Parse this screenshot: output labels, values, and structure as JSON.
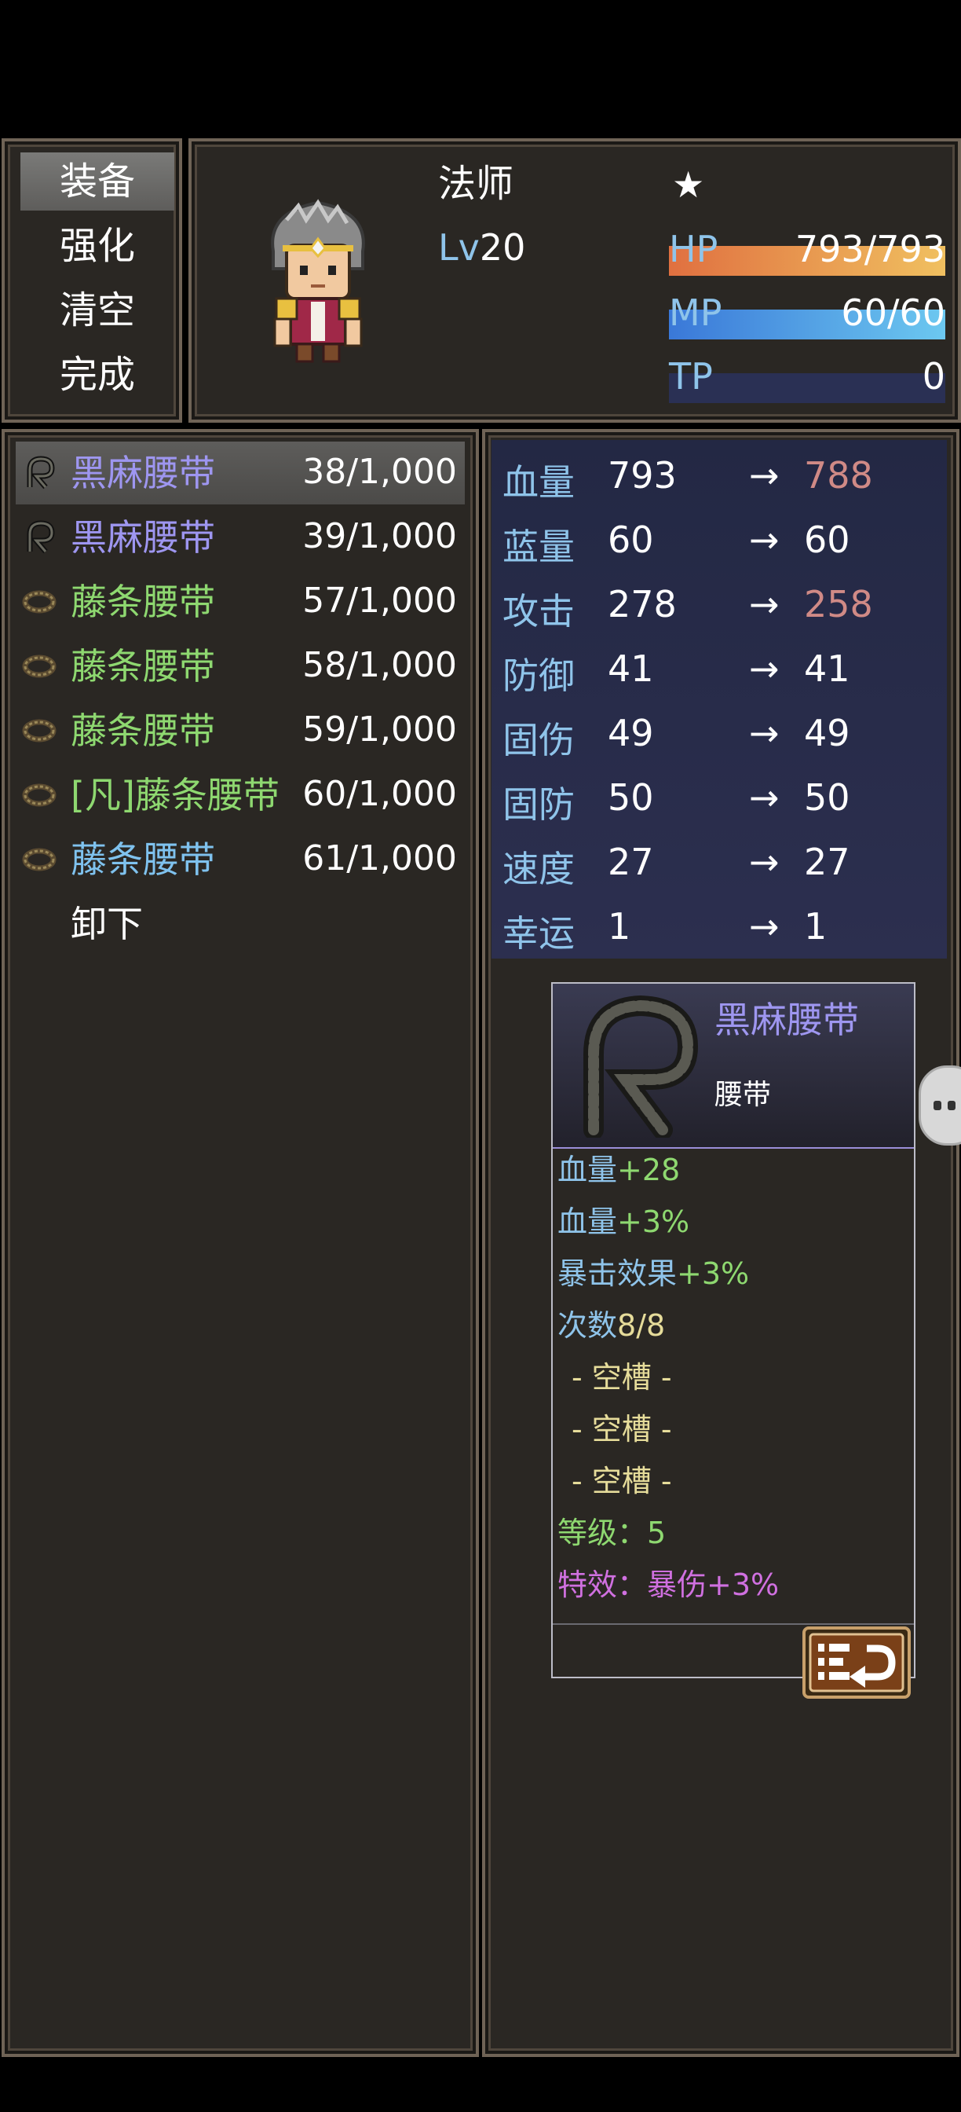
{
  "commands": [
    {
      "label": "装备"
    },
    {
      "label": "强化"
    },
    {
      "label": "清空"
    },
    {
      "label": "完成"
    }
  ],
  "actor": {
    "class_name": "法师",
    "level_prefix": "Lv",
    "level": "20",
    "star": "★",
    "hp": {
      "label": "HP",
      "value": "793/793",
      "fill": 1.0
    },
    "mp": {
      "label": "MP",
      "value": "60/60",
      "fill": 1.0
    },
    "tp": {
      "label": "TP",
      "value": "0",
      "fill": 0.0
    }
  },
  "items": [
    {
      "name": "黑麻腰带",
      "count": "38/1,000",
      "color": "#9e96f0",
      "icon": "black-hemp-belt-icon"
    },
    {
      "name": "黑麻腰带",
      "count": "39/1,000",
      "color": "#9e96f0",
      "icon": "black-hemp-belt-icon"
    },
    {
      "name": "藤条腰带",
      "count": "57/1,000",
      "color": "#8ed870",
      "icon": "rattan-belt-icon"
    },
    {
      "name": "藤条腰带",
      "count": "58/1,000",
      "color": "#8ed870",
      "icon": "rattan-belt-icon"
    },
    {
      "name": "藤条腰带",
      "count": "59/1,000",
      "color": "#8ed870",
      "icon": "rattan-belt-icon"
    },
    {
      "name": "[凡]藤条腰带",
      "count": "60/1,000",
      "color": "#8ed870",
      "icon": "rattan-belt-icon"
    },
    {
      "name": "藤条腰带",
      "count": "61/1,000",
      "color": "#7fc2ee",
      "icon": "rattan-belt-icon"
    },
    {
      "name": "卸下",
      "count": "",
      "color": "#ffffff",
      "icon": ""
    }
  ],
  "stats": [
    {
      "label": "血量",
      "current": "793",
      "arrow": "→",
      "new": "788",
      "new_color": "#d08a86"
    },
    {
      "label": "蓝量",
      "current": "60",
      "arrow": "→",
      "new": "60",
      "new_color": "#ffffff"
    },
    {
      "label": "攻击",
      "current": "278",
      "arrow": "→",
      "new": "258",
      "new_color": "#d08a86"
    },
    {
      "label": "防御",
      "current": "41",
      "arrow": "→",
      "new": "41",
      "new_color": "#ffffff"
    },
    {
      "label": "固伤",
      "current": "49",
      "arrow": "→",
      "new": "49",
      "new_color": "#ffffff"
    },
    {
      "label": "固防",
      "current": "50",
      "arrow": "→",
      "new": "50",
      "new_color": "#ffffff"
    },
    {
      "label": "速度",
      "current": "27",
      "arrow": "→",
      "new": "27",
      "new_color": "#ffffff"
    },
    {
      "label": "幸运",
      "current": "1",
      "arrow": "→",
      "new": "1",
      "new_color": "#ffffff"
    }
  ],
  "tooltip": {
    "name": "黑麻腰带",
    "type": "腰带",
    "lines": [
      {
        "label": "血量",
        "value": "+28"
      },
      {
        "label": "血量",
        "value": "+3%"
      },
      {
        "label": "暴击效果",
        "value": "+3%"
      },
      {
        "label": "次数",
        "value": "8/8"
      }
    ],
    "slots": [
      "- 空槽 -",
      "- 空槽 -",
      "- 空槽 -"
    ],
    "grade": "等级：5",
    "effect": "特效：暴伤+3%"
  },
  "colors": {
    "hp_bar": "#e8a050",
    "mp_bar": "#4aa0e0",
    "tp_bar": "#2a3054",
    "system_blue": "#8fc4ea",
    "bonus_green": "#8ed870",
    "slot_yellow": "#e6dc9a",
    "effect_purple": "#d070e0"
  }
}
